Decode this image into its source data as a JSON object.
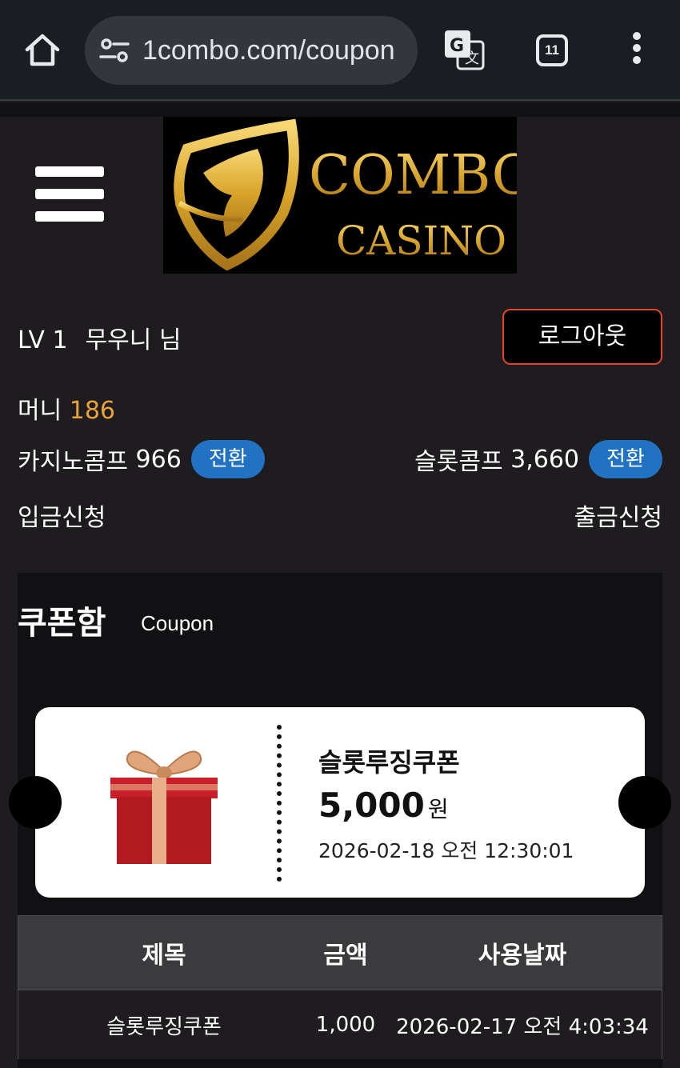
{
  "browser": {
    "url": "1combo.com/coupon",
    "tab_count": "11",
    "icons": [
      "home-icon",
      "site-settings-icon",
      "translate-icon",
      "tabs-icon",
      "more-menu-icon"
    ]
  },
  "header": {
    "logo_line1": "COMBO",
    "logo_line2": "CASINO"
  },
  "user": {
    "level": "LV 1",
    "name": "무우니 님",
    "logout_label": "로그아웃",
    "money_label": "머니",
    "money_value": "186",
    "casino_comp_label": "카지노콤프",
    "casino_comp_value": "966",
    "slot_comp_label": "슬롯콤프",
    "slot_comp_value": "3,660",
    "convert_label": "전환",
    "deposit_label": "입금신청",
    "withdraw_label": "출금신청"
  },
  "coupon": {
    "title": "쿠폰함",
    "subtitle": "Coupon",
    "card": {
      "name": "슬롯루징쿠폰",
      "amount": "5,000",
      "unit": "원",
      "date": "2026-02-18 오전 12:30:01"
    },
    "table": {
      "headers": [
        "제목",
        "금액",
        "사용날짜"
      ],
      "rows": [
        [
          "슬롯루징쿠폰",
          "1,000",
          "2026-02-17 오전 4:03:34"
        ]
      ]
    }
  },
  "colors": {
    "accent_gold": "#e8a33b",
    "button_blue": "#2272c4",
    "logout_border": "#e0452d"
  }
}
